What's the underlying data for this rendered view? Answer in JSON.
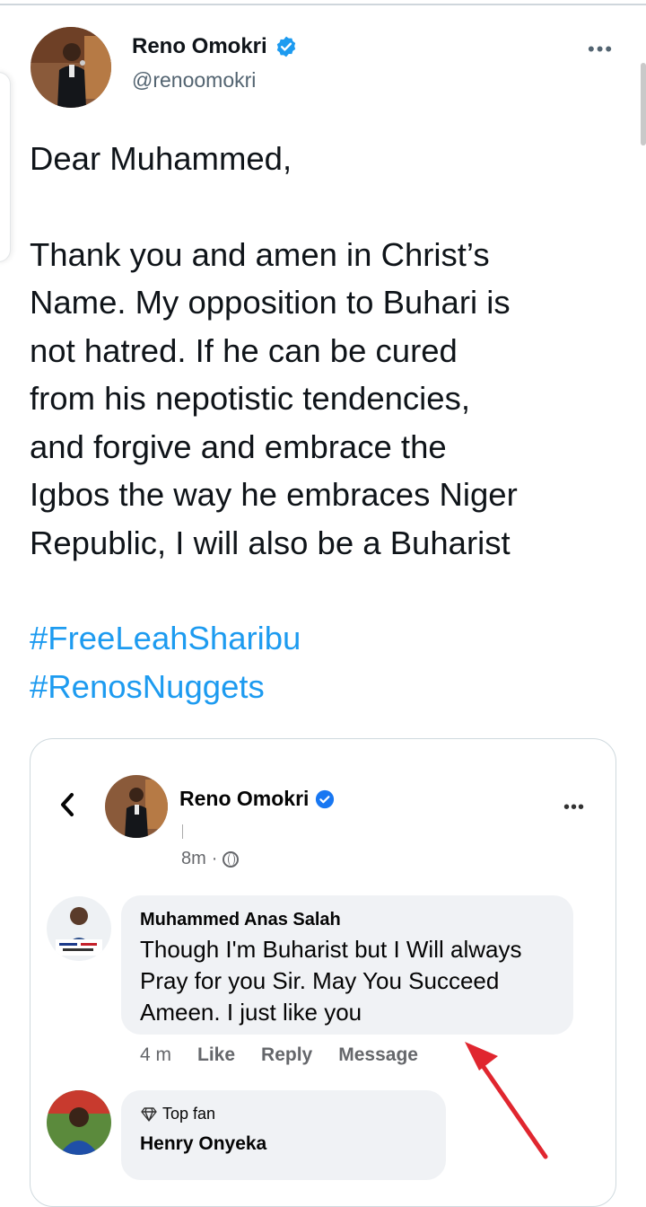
{
  "tweet": {
    "author_name": "Reno Omokri",
    "handle": "@renoomokri",
    "more_label": "•••",
    "greeting": "Dear Muhammed,",
    "lines": [
      "Thank you and amen in Christ’s",
      "Name. My opposition to Buhari is",
      "not hatred. If he can be cured",
      "from his nepotistic tendencies,",
      "and forgive and embrace the",
      "Igbos the way he embraces Niger",
      "Republic, I will also be a Buharist"
    ],
    "hashtags": [
      "#FreeLeahSharibu",
      "#RenosNuggets"
    ],
    "colors": {
      "link": "#1d9bf0",
      "verified": "#1d9bf0"
    }
  },
  "embed": {
    "back_icon": "chevron-left-icon",
    "post_author": "Reno Omokri",
    "post_time": "8m",
    "post_time_sep": "·",
    "more_label": "•••",
    "comments": [
      {
        "author": "Muhammed Anas Salah",
        "text_lines": [
          "Though I'm Buharist but I Will always",
          "Pray for you Sir. May You Succeed",
          "Ameen. I just like you"
        ],
        "time": "4 m",
        "actions": [
          "Like",
          "Reply",
          "Message"
        ]
      },
      {
        "badge": "Top fan",
        "author": "Henry Onyeka"
      }
    ],
    "annotation_color": "#e0262f"
  }
}
